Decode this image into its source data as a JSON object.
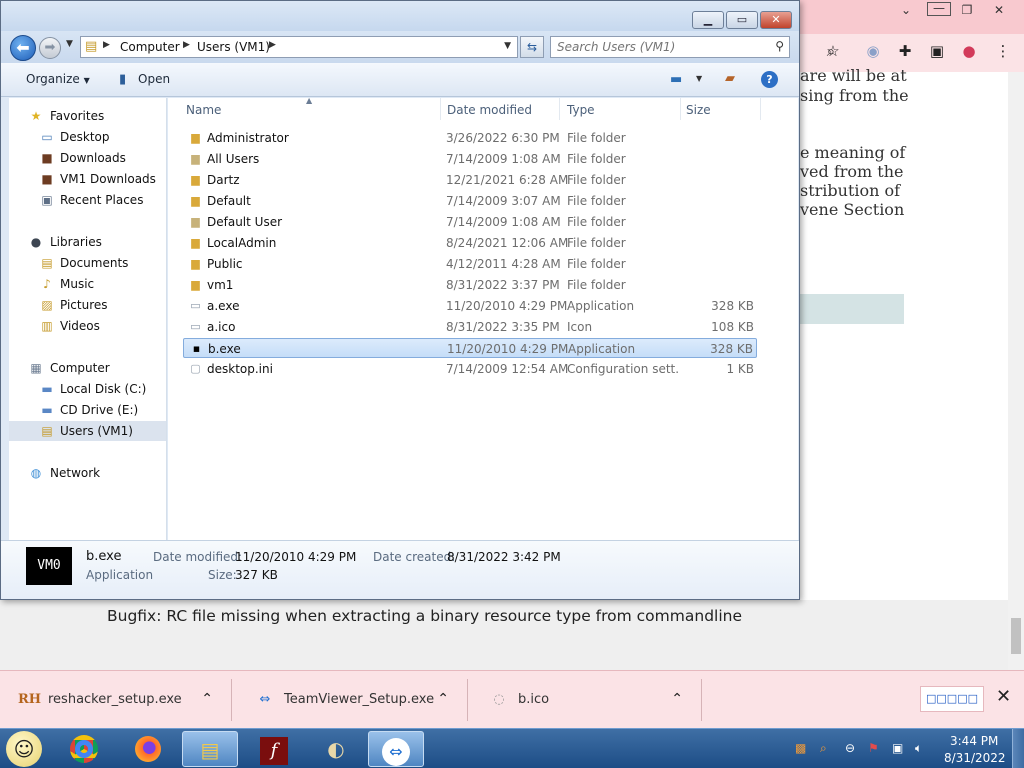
{
  "browser": {
    "article_lines": [
      "are will be at",
      "sing from the",
      "e meaning of",
      "ved from the",
      "stribution of",
      "vene Section"
    ],
    "bugfix_text": "Bugfix:  RC file missing when extracting a binary resource type from commandline",
    "downloads": [
      {
        "icon": "RH",
        "name": "reshacker_setup.exe"
      },
      {
        "icon": "⇔",
        "name": "TeamViewer_Setup.exe"
      },
      {
        "icon": "◌",
        "name": "b.ico"
      }
    ],
    "show_all_label": "□□□□□"
  },
  "explorer": {
    "address": {
      "segments": [
        "Computer",
        "Users (VM1)"
      ]
    },
    "search": {
      "placeholder": "Search Users (VM1)"
    },
    "command_bar": {
      "organize": "Organize",
      "open": "Open"
    },
    "nav": {
      "favorites": "Favorites",
      "favorites_items": [
        "Desktop",
        "Downloads",
        "VM1 Downloads",
        "Recent Places"
      ],
      "libraries": "Libraries",
      "libraries_items": [
        "Documents",
        "Music",
        "Pictures",
        "Videos"
      ],
      "computer": "Computer",
      "computer_items": [
        "Local Disk (C:)",
        "CD Drive (E:)",
        "Users (VM1)"
      ],
      "network": "Network"
    },
    "columns": {
      "name": "Name",
      "date": "Date modified",
      "type": "Type",
      "size": "Size"
    },
    "files": [
      {
        "name": "Administrator",
        "date": "3/26/2022 6:30 PM",
        "type": "File folder",
        "size": "",
        "icon": "folder"
      },
      {
        "name": "All Users",
        "date": "7/14/2009 1:08 AM",
        "type": "File folder",
        "size": "",
        "icon": "shortcut-folder"
      },
      {
        "name": "Dartz",
        "date": "12/21/2021 6:28 AM",
        "type": "File folder",
        "size": "",
        "icon": "folder"
      },
      {
        "name": "Default",
        "date": "7/14/2009 3:07 AM",
        "type": "File folder",
        "size": "",
        "icon": "folder"
      },
      {
        "name": "Default User",
        "date": "7/14/2009 1:08 AM",
        "type": "File folder",
        "size": "",
        "icon": "shortcut-folder"
      },
      {
        "name": "LocalAdmin",
        "date": "8/24/2021 12:06 AM",
        "type": "File folder",
        "size": "",
        "icon": "folder"
      },
      {
        "name": "Public",
        "date": "4/12/2011 4:28 AM",
        "type": "File folder",
        "size": "",
        "icon": "folder"
      },
      {
        "name": "vm1",
        "date": "8/31/2022 3:37 PM",
        "type": "File folder",
        "size": "",
        "icon": "folder"
      },
      {
        "name": "a.exe",
        "date": "11/20/2010 4:29 PM",
        "type": "Application",
        "size": "328 KB",
        "icon": "exe"
      },
      {
        "name": "a.ico",
        "date": "8/31/2022 3:35 PM",
        "type": "Icon",
        "size": "108 KB",
        "icon": "exe"
      },
      {
        "name": "b.exe",
        "date": "11/20/2010 4:29 PM",
        "type": "Application",
        "size": "328 KB",
        "icon": "vm0"
      },
      {
        "name": "desktop.ini",
        "date": "7/14/2009 12:54 AM",
        "type": "Configuration sett...",
        "size": "1 KB",
        "icon": "ini"
      }
    ],
    "selected_file": "b.exe",
    "details": {
      "thumb_text": "VM0",
      "name": "b.exe",
      "kind": "Application",
      "date_modified_label": "Date modified:",
      "date_modified": "11/20/2010 4:29 PM",
      "date_created_label": "Date created:",
      "date_created": "8/31/2022 3:42 PM",
      "size_label": "Size:",
      "size": "327 KB"
    }
  },
  "taskbar": {
    "time": "3:44 PM",
    "date": "8/31/2022"
  },
  "colors": {
    "selection": "#c5ddf8",
    "taskbar": "#1d4d86",
    "browser_tint": "#fbe3e6"
  }
}
